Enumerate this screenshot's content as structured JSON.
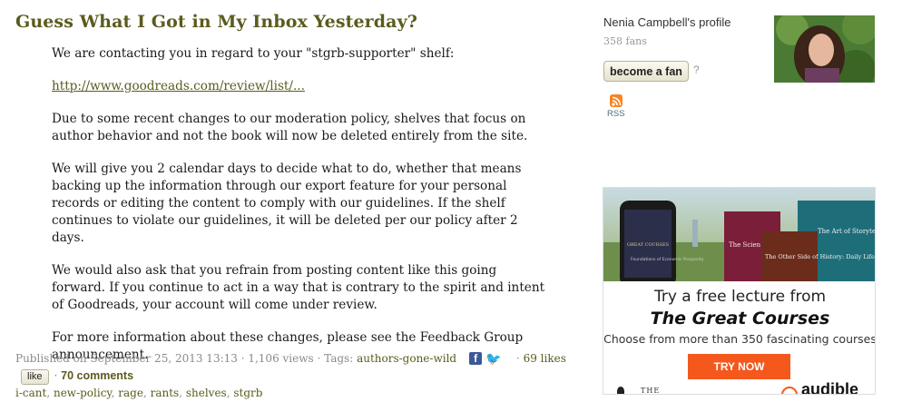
{
  "post": {
    "title": "Guess What I Got in My Inbox Yesterday?",
    "paragraphs": [
      "We are contacting you in regard to your \"stgrb-supporter\" shelf:",
      "http://www.goodreads.com/review/list/...",
      "Due to some recent changes to our moderation policy, shelves that focus on author behavior and not the book will now be deleted entirely from the site.",
      "We will give you 2 calendar days to decide what to do, whether that means backing up the information through our export feature for your personal records or editing the content to comply with our guidelines. If the shelf continues to violate our guidelines, it will be deleted per our policy after 2 days.",
      "We would also ask that you refrain from posting content like this going forward. If you continue to act in a way that is contrary to the spirit and intent of Goodreads, your account will come under review.",
      "For more information about these changes, please see the Feedback Group announcement."
    ],
    "meta": {
      "published": "Published on September 25, 2013 13:13",
      "views": "1,106 views",
      "tags_label": "Tags:",
      "tags": [
        "authors-gone-wild",
        "i-cant",
        "new-policy",
        "rage",
        "rants",
        "shelves",
        "stgrb"
      ],
      "likes": "69 likes",
      "like_button": "like",
      "comments": "70 comments"
    }
  },
  "sidebar": {
    "profile_name": "Nenia Campbell's profile",
    "fans": "358 fans",
    "fan_button": "become a fan",
    "help": "?",
    "rss_label": "RSS",
    "ad": {
      "headline": "Try a free lecture from",
      "brand": "The Great Courses",
      "subline": "Choose from more than 350 fascinating courses",
      "cta": "TRY NOW",
      "foot_left": "THE",
      "foot_right": "audible",
      "book_great_courses": "GREAT COURSES",
      "book1": "The Art of Storytelling:",
      "book1b": "nals",
      "book2": "The Scien of Natura",
      "book3": "The Other Side of History: Daily Life in the Ancient World",
      "phone_text": "Foundations of Economic Prosperity"
    }
  },
  "colors": {
    "title": "#5b5b1e",
    "link": "#5b5b1e",
    "comments": "#385c2c",
    "cta": "#f4581d",
    "rss": "#f78422",
    "facebook": "#3b5998",
    "twitter": "#1da1f2"
  }
}
